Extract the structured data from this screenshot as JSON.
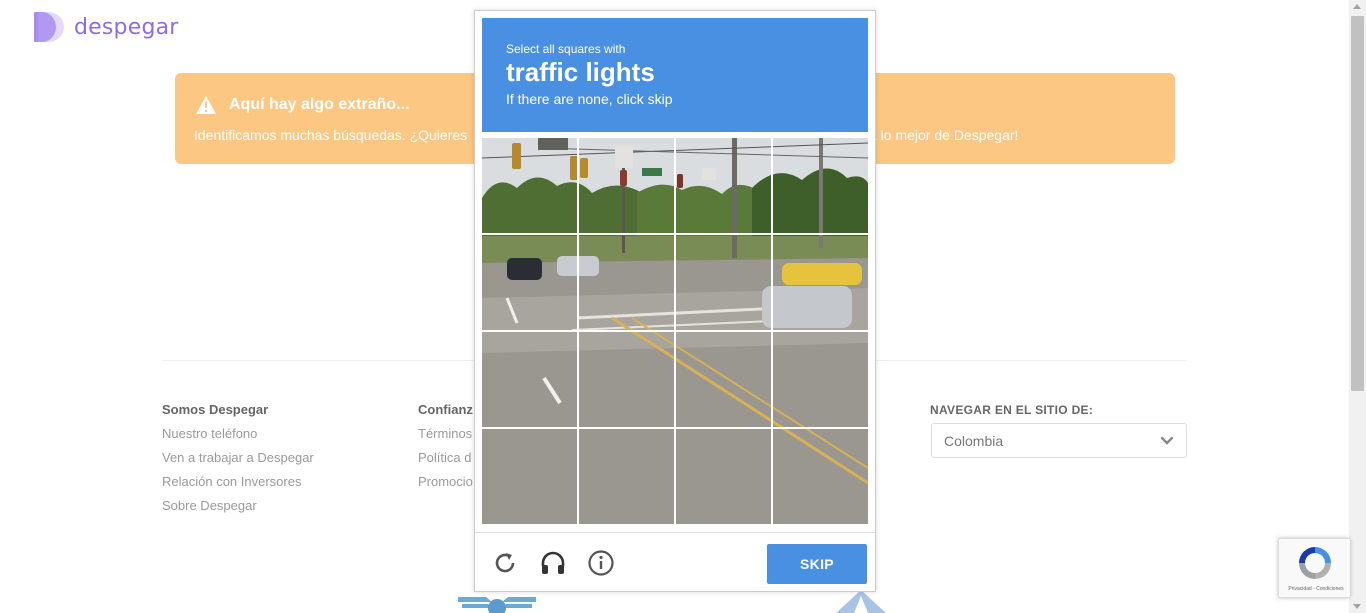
{
  "brand": {
    "name": "despegar",
    "color": "#8a6ee8"
  },
  "banner": {
    "title": "Aquí hay algo extraño...",
    "text_left": "Identificamos muchas búsquedas. ¿Quieres",
    "text_right": "a lo mejor de Despegar!",
    "bg_color": "#fcc782"
  },
  "footer": {
    "columns": [
      {
        "title": "Somos Despegar",
        "links": [
          "Nuestro teléfono",
          "Ven a trabajar a Despegar",
          "Relación con Inversores",
          "Sobre Despegar"
        ]
      },
      {
        "title": "Confianz",
        "links": [
          "Términos",
          "Política d",
          "Promocio"
        ]
      }
    ],
    "nav_site_label": "NAVEGAR EN EL SITIO DE:",
    "country_selected": "Colombia"
  },
  "captcha": {
    "header_line1": "Select all squares with",
    "header_target": "traffic lights",
    "header_line3": "If there are none, click skip",
    "accent_color": "#4a90e2",
    "skip_label": "SKIP",
    "icons": [
      "reload-icon",
      "audio-headphones-icon",
      "info-icon"
    ],
    "grid": {
      "rows": 4,
      "cols": 4
    }
  },
  "recaptcha_badge": {
    "text": "Privacidad - Condiciones"
  }
}
